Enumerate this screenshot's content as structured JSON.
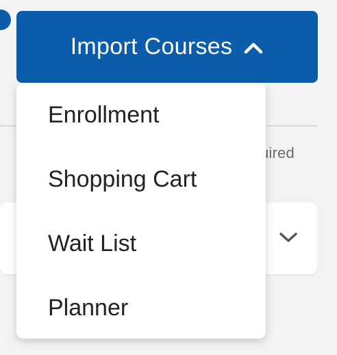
{
  "import_button": {
    "label": "Import Courses",
    "icon": "chevron-up-icon",
    "color": "#0b5cab",
    "expanded": true
  },
  "menu": {
    "items": [
      {
        "label": "Enrollment"
      },
      {
        "label": "Shopping Cart"
      },
      {
        "label": "Wait List"
      },
      {
        "label": "Planner"
      }
    ]
  },
  "background": {
    "required_text": "uired",
    "select_icon": "chevron-down-icon"
  }
}
